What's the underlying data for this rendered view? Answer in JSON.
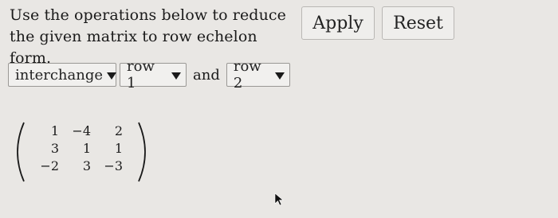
{
  "instructions": {
    "line1": "Use the operations below to reduce",
    "line2": "the given matrix to row echelon form."
  },
  "buttons": {
    "apply_label": "Apply",
    "reset_label": "Reset"
  },
  "operation": {
    "type_selected": "interchange",
    "row_a_selected": "row 1",
    "connector": "and",
    "row_b_selected": "row 2"
  },
  "matrix": {
    "rows": [
      [
        "1",
        "−4",
        "2"
      ],
      [
        "3",
        "1",
        "1"
      ],
      [
        "−2",
        "3",
        "−3"
      ]
    ]
  },
  "icons": {
    "dropdown": "caret-down-icon",
    "pointer": "mouse-cursor-icon"
  }
}
